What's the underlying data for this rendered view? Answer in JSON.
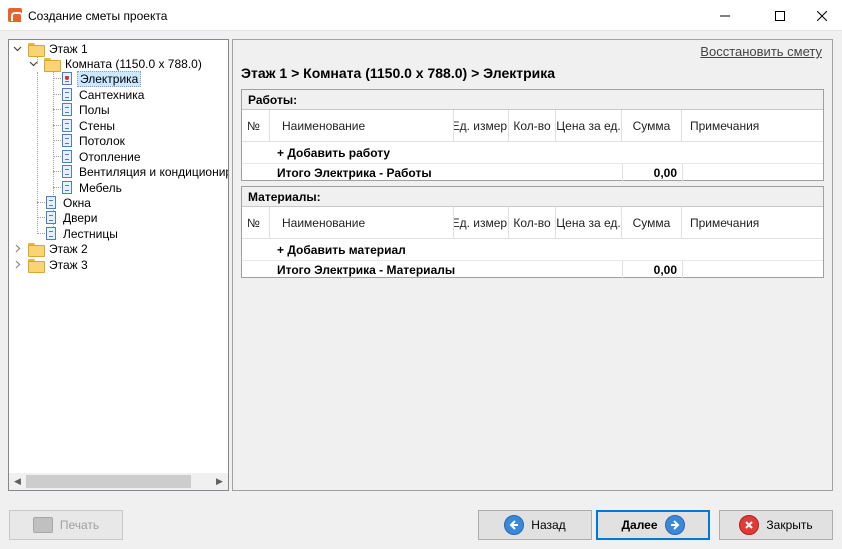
{
  "window": {
    "title": "Создание сметы проекта",
    "minimize": "—",
    "maximize": "☐",
    "close": "✕"
  },
  "tree": {
    "floor1": "Этаж 1",
    "room": "Комната (1150.0 x 788.0)",
    "items": [
      "Электрика",
      "Сантехника",
      "Полы",
      "Стены",
      "Потолок",
      "Отопление",
      "Вентиляция и кондиционирование",
      "Мебель"
    ],
    "room_items": [
      "Окна",
      "Двери",
      "Лестницы"
    ],
    "floor2": "Этаж 2",
    "floor3": "Этаж 3"
  },
  "main": {
    "restore_link": "Восстановить смету",
    "breadcrumb": "Этаж 1 > Комната (1150.0 x 788.0) > Электрика"
  },
  "columns": {
    "num": "№",
    "name": "Наименование",
    "unit": "Ед. измер.",
    "qty": "Кол-во",
    "price": "Цена за ед.",
    "sum": "Сумма",
    "notes": "Примечания"
  },
  "works": {
    "title": "Работы:",
    "add": "+ Добавить работу",
    "total_label": "Итого Электрика - Работы",
    "total_value": "0,00"
  },
  "materials": {
    "title": "Материалы:",
    "add": "+ Добавить материал",
    "total_label": "Итого Электрика - Материалы",
    "total_value": "0,00"
  },
  "buttons": {
    "print": "Печать",
    "back": "Назад",
    "next": "Далее",
    "close": "Закрыть"
  }
}
